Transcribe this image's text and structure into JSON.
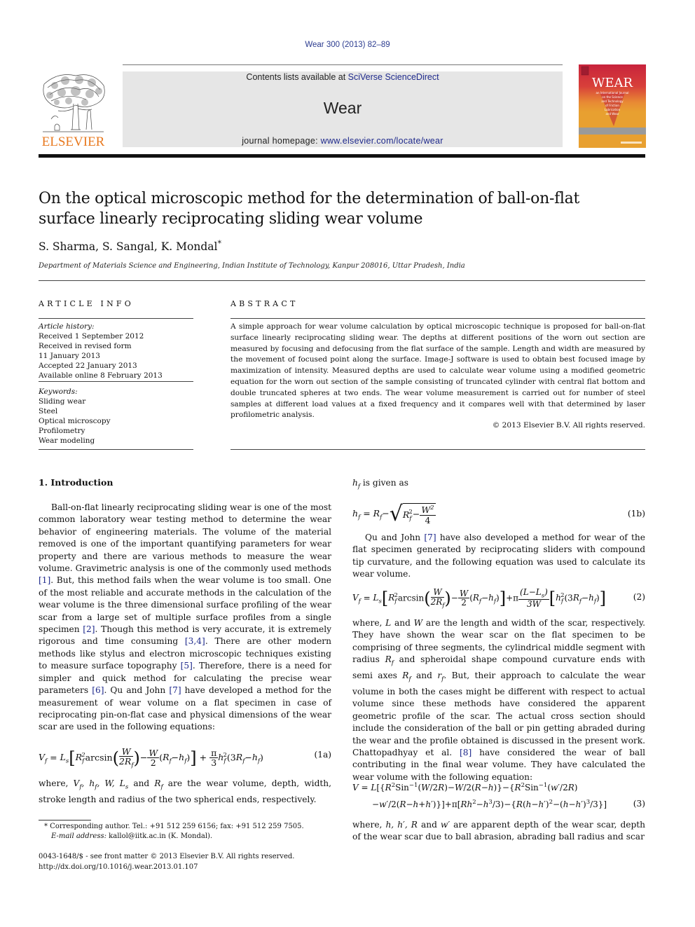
{
  "header": {
    "citation": "Wear 300 (2013) 82–89",
    "contents_prefix": "Contents lists available at ",
    "contents_link": "SciVerse ScienceDirect",
    "journal_name": "Wear",
    "homepage_prefix": "journal homepage: ",
    "homepage_link": "www.elsevier.com/locate/wear",
    "publisher_logo_text": "ELSEVIER",
    "cover_title": "WEAR",
    "cover_subtitle": [
      "an International Journal",
      "on the Science",
      "and Technology",
      "of Friction",
      "Lubrication",
      "and Wear"
    ],
    "colors": {
      "link": "#1f2a8c",
      "elsevier_orange": "#e8791f",
      "banner_bg": "#e6e6e6",
      "cover_red": "#c8233c",
      "cover_orange": "#e8a030"
    }
  },
  "article": {
    "title_line1": "On the optical microscopic method for the determination of ball-on-flat",
    "title_line2": "surface linearly reciprocating sliding wear volume",
    "authors": "S. Sharma, S. Sangal, K. Mondal",
    "corresponding_mark": "*",
    "affiliation": "Department of Materials Science and Engineering, Indian Institute of Technology, Kanpur 208016, Uttar Pradesh, India"
  },
  "article_info": {
    "heading": "ARTICLE INFO",
    "history_label": "Article history:",
    "history": [
      "Received 1 September 2012",
      "Received in revised form",
      "11 January 2013",
      "Accepted 22 January 2013",
      "Available online 8 February 2013"
    ],
    "keywords_label": "Keywords:",
    "keywords": [
      "Sliding wear",
      "Steel",
      "Optical microscopy",
      "Profilometry",
      "Wear modeling"
    ]
  },
  "abstract": {
    "heading": "ABSTRACT",
    "text": "A simple approach for wear volume calculation by optical microscopic technique is proposed for ball-on-flat surface linearly reciprocating sliding wear. The depths at different positions of the worn out section are measured by focusing and defocusing from the flat surface of the sample. Length and width are measured by the movement of focused point along the surface. Image-J software is used to obtain best focused image by maximization of intensity. Measured depths are used to calculate wear volume using a modified geometric equation for the worn out section of the sample consisting of truncated cylinder with central flat bottom and double truncated spheres at two ends. The wear volume measurement is carried out for number of steel samples at different load values at a fixed frequency and it compares well with that determined by laser profilometric analysis.",
    "copyright": "© 2013 Elsevier B.V. All rights reserved."
  },
  "body": {
    "section1_heading": "1.  Introduction",
    "p1": {
      "t1": "Ball-on-flat linearly reciprocating sliding wear is one of the most common laboratory wear testing method to determine the wear behavior of engineering materials. The volume of the material removed is one of the important quantifying parameters for wear property and there are various methods to measure the wear volume. Gravimetric analysis is one of the commonly used methods ",
      "r1": "[1]",
      "t2": ". But, this method fails when the wear volume is too small. One of the most reliable and accurate methods in the calculation of the wear volume is the three dimensional surface profiling of the wear scar from a large set of multiple surface profiles from a single specimen ",
      "r2": "[2]",
      "t3": ". Though this method is very accurate, it is extremely rigorous and time consuming ",
      "r3": "[3,4]",
      "t4": ". There are other modern methods like stylus and electron microscopic techniques existing to measure surface topography ",
      "r4": "[5]",
      "t5": ". Therefore, there is a need for simpler and quick method for calculating the precise wear parameters ",
      "r5": "[6]",
      "t6": ". Qu and John ",
      "r6": "[7]",
      "t7": " have developed a method for the measurement of wear volume on a flat specimen in case of reciprocating pin-on-flat case and physical dimensions of the wear scar are used in the following equations:"
    },
    "eq1a_number": "(1a)",
    "p2": {
      "t1": "where, ",
      "t2": " are the wear volume, depth, width, stroke length and radius of the two spherical ends, respectively."
    },
    "hf_given": "is given as",
    "eq1b_number": "(1b)",
    "p3": {
      "t1": "Qu and John ",
      "r1": "[7]",
      "t2": " have also developed a method for wear of the flat specimen generated by reciprocating sliders with compound tip curvature, and the following equation was used to calculate its wear volume."
    },
    "eq2_number": "(2)",
    "p4": {
      "t1": "where, ",
      "t2": " and ",
      "t3": " are the length and width of the scar, respectively. They have shown the wear scar on the flat specimen to be comprising of three segments, the cylindrical middle segment with radius ",
      "t4": " and spheroidal shape compound curvature ends with semi axes ",
      "t5": " and ",
      "t6": ". But, their approach to calculate the wear volume in both the cases might be different with respect to actual volume since these methods have considered the apparent geometric profile of the scar. The actual cross section should include the consideration of the ball or pin getting abraded during the wear and the profile obtained is discussed in the present work. Chattopadhyay et al. ",
      "r1": "[8]",
      "t7": " have considered the wear of ball contributing in the final wear volume. They have calculated the wear volume with the following equation:"
    },
    "eq3_number": "(3)",
    "p5": {
      "t1": "where, ",
      "t2": " are apparent depth of the wear scar, depth of the wear scar due to ball abrasion, abrading ball radius and scar"
    }
  },
  "footnotes": {
    "corresponding": "* Corresponding author. Tel.: +91 512 259 6156; fax: +91 512 259 7505.",
    "email_label": "E-mail address:",
    "email": "kallol@iitk.ac.in (K. Mondal).",
    "issn": "0043-1648/$ - see front matter © 2013 Elsevier B.V. All rights reserved.",
    "doi": "http://dx.doi.org/10.1016/j.wear.2013.01.107"
  }
}
